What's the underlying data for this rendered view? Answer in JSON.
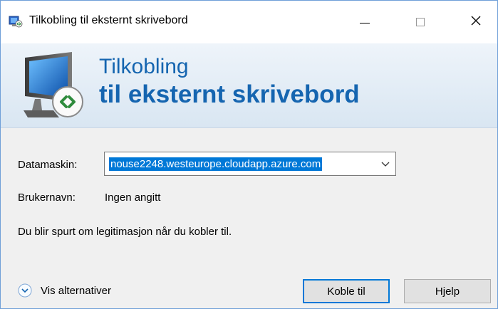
{
  "window": {
    "title": "Tilkobling til eksternt skrivebord",
    "title_icon": "remote-desktop-icon"
  },
  "titlebar_buttons": {
    "close_glyph": "✕"
  },
  "banner": {
    "line1": "Tilkobling",
    "line2": "til eksternt skrivebord",
    "icon": "monitor-remote-icon"
  },
  "form": {
    "computer_label": "Datamaskin:",
    "computer_value": "nouse2248.westeurope.cloudapp.azure.com",
    "username_label": "Brukernavn:",
    "username_value": "Ingen angitt",
    "info_text": "Du blir spurt om legitimasjon når du kobler til."
  },
  "footer": {
    "options_label": "Vis alternativer",
    "connect_label": "Koble til",
    "help_label": "Hjelp"
  },
  "colors": {
    "accent": "#1565b0",
    "selection": "#0078d7"
  }
}
